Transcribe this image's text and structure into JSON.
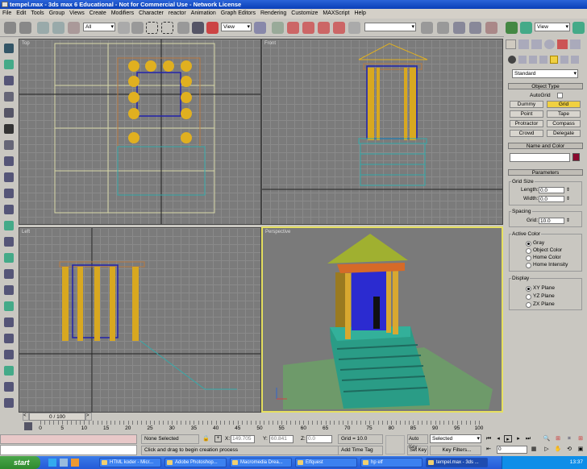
{
  "window": {
    "title": "tempel.max - 3ds max 6 Educational - Not for Commercial Use - Network License"
  },
  "menu": [
    "File",
    "Edit",
    "Tools",
    "Group",
    "Views",
    "Create",
    "Modifiers",
    "Character",
    "reactor",
    "Animation",
    "Graph Editors",
    "Rendering",
    "Customize",
    "MAXScript",
    "Help"
  ],
  "toolbar": {
    "selection_filter": "All",
    "reference_coord": "View",
    "named_selection": ""
  },
  "viewports": {
    "top": "Top",
    "front": "Front",
    "left": "Left",
    "perspective": "Perspective"
  },
  "command_panel": {
    "view_dropdown": "View",
    "category": "Standard",
    "object_type": {
      "title": "Object Type",
      "autogrid": "AutoGrid",
      "buttons": [
        "Dummy",
        "Grid",
        "Point",
        "Tape",
        "Protractor",
        "Compass",
        "Crowd",
        "Delegate"
      ],
      "active": "Grid"
    },
    "name_and_color": {
      "title": "Name and Color",
      "name": "",
      "color": "#8b0a2e"
    },
    "parameters": {
      "title": "Parameters",
      "grid_size": {
        "label": "Grid Size",
        "length_label": "Length:",
        "length": "0.0",
        "width_label": "Width:",
        "width": "0.0"
      },
      "spacing": {
        "label": "Spacing",
        "grid_label": "Grid:",
        "grid": "10.0"
      },
      "active_color": {
        "label": "Active Color",
        "options": [
          "Gray",
          "Object Color",
          "Home Color",
          "Home Intensity"
        ],
        "selected": "Gray"
      },
      "display": {
        "label": "Display",
        "options": [
          "XY Plane",
          "YZ Plane",
          "ZX Plane"
        ],
        "selected": "XY Plane"
      }
    }
  },
  "timeline": {
    "frame": "0 / 100",
    "ticks": [
      "0",
      "5",
      "10",
      "15",
      "20",
      "25",
      "30",
      "35",
      "40",
      "45",
      "50",
      "55",
      "60",
      "65",
      "70",
      "75",
      "80",
      "85",
      "90",
      "95",
      "100"
    ]
  },
  "status": {
    "selection": "None Selected",
    "x_label": "X:",
    "x": "149.705",
    "y_label": "Y:",
    "y": "60.841",
    "z_label": "Z:",
    "z": "0.0",
    "grid": "Grid = 10.0",
    "prompt": "Click and drag to begin creation process",
    "add_time_tag": "Add Time Tag",
    "auto_key": "Auto Key",
    "set_key": "Set Key",
    "key_mode": "Selected",
    "key_filters": "Key Filters...",
    "current_frame": "0"
  },
  "taskbar": {
    "start": "start",
    "tasks": [
      "HTML koder - Micr...",
      "Adobe Photoshop...",
      "Macromedia Drea...",
      "Elfquest",
      "hp elf",
      "tempel.max - 3ds ..."
    ],
    "active": "tempel.max - 3ds ...",
    "clock": "13:37"
  }
}
